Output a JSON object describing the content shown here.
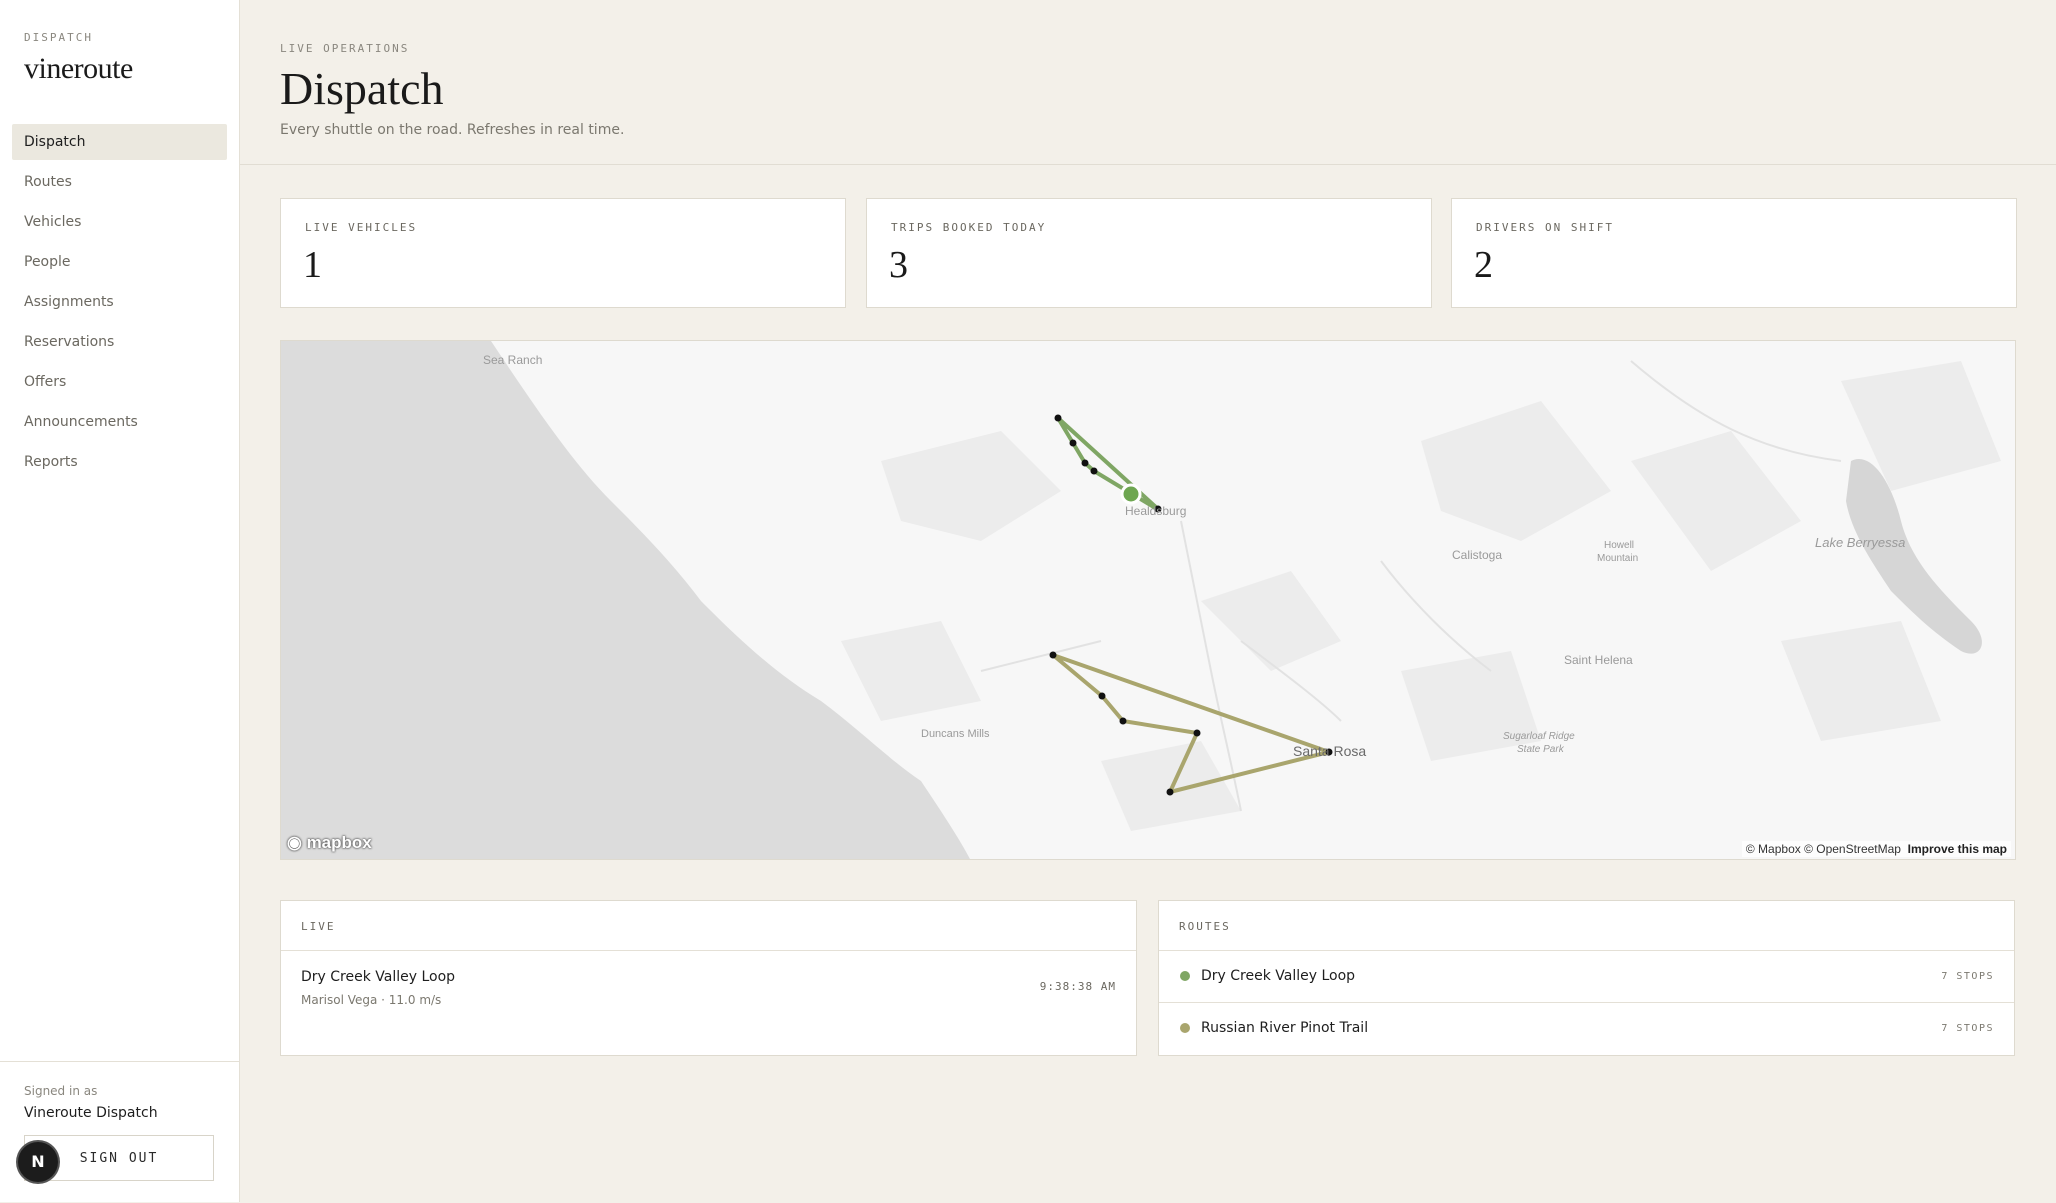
{
  "sidebar": {
    "eyebrow": "DISPATCH",
    "brand": "vineroute",
    "nav": [
      {
        "label": "Dispatch",
        "active": true
      },
      {
        "label": "Routes"
      },
      {
        "label": "Vehicles"
      },
      {
        "label": "People"
      },
      {
        "label": "Assignments"
      },
      {
        "label": "Reservations"
      },
      {
        "label": "Offers"
      },
      {
        "label": "Announcements"
      },
      {
        "label": "Reports"
      }
    ],
    "signed_in_label": "Signed in as",
    "signed_in_name": "Vineroute Dispatch",
    "sign_out": "SIGN OUT",
    "badge": "N"
  },
  "header": {
    "eyebrow": "LIVE OPERATIONS",
    "title": "Dispatch",
    "subtitle": "Every shuttle on the road. Refreshes in real time."
  },
  "stats": [
    {
      "label": "LIVE VEHICLES",
      "value": "1"
    },
    {
      "label": "TRIPS BOOKED TODAY",
      "value": "3"
    },
    {
      "label": "DRIVERS ON SHIFT",
      "value": "2"
    }
  ],
  "map": {
    "place_labels": {
      "sea_ranch": "Sea Ranch",
      "healdsburg": "Healdsburg",
      "calistoga": "Calistoga",
      "howell_1": "Howell",
      "howell_2": "Mountain",
      "lake_berryessa": "Lake Berryessa",
      "saint_helena": "Saint Helena",
      "duncans_mills": "Duncans Mills",
      "santa_rosa": "Santa Rosa",
      "sugarloaf_1": "Sugarloaf Ridge",
      "sugarloaf_2": "State Park"
    },
    "attribution": "© Mapbox © OpenStreetMap",
    "improve": "Improve this map",
    "logo": "mapbox",
    "route_colors": {
      "dry_creek": "#7fa664",
      "russian_river": "#a9a56d"
    },
    "vehicle_color": "#6ea651"
  },
  "live": {
    "heading": "LIVE",
    "items": [
      {
        "name": "Dry Creek Valley Loop",
        "meta": "Marisol Vega · 11.0 m/s",
        "time": "9:38:38 AM"
      }
    ]
  },
  "routes": {
    "heading": "ROUTES",
    "items": [
      {
        "name": "Dry Creek Valley Loop",
        "stops": "7 STOPS",
        "color": "#7fa664"
      },
      {
        "name": "Russian River Pinot Trail",
        "stops": "7 STOPS",
        "color": "#a9a56d"
      }
    ]
  }
}
